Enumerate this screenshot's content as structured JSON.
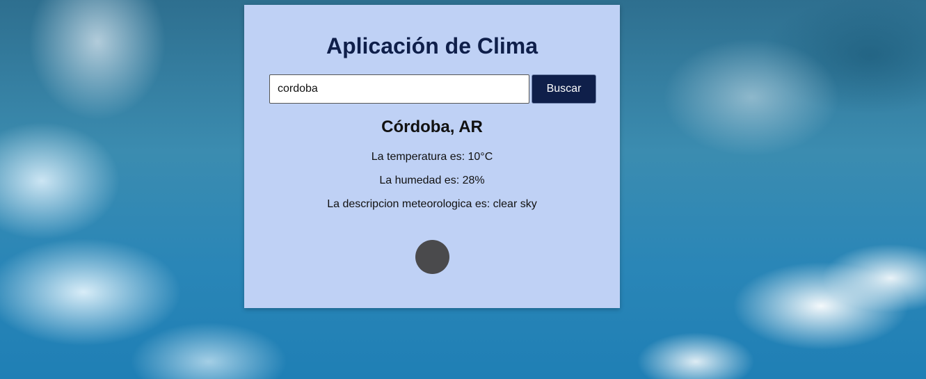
{
  "app": {
    "title": "Aplicación de Clima"
  },
  "search": {
    "value": "cordoba",
    "placeholder": "",
    "button_label": "Buscar"
  },
  "weather": {
    "city": "Córdoba, AR",
    "temperature_text": "La temperatura es: 10°C",
    "humidity_text": "La humedad es: 28%",
    "description_text": "La descripcion meteorologica es: clear sky",
    "icon": "weather-icon"
  },
  "colors": {
    "card_background": "#bfd1f5",
    "title_color": "#0f1f4a",
    "button_background": "#0f1f4a",
    "icon_color": "#4a4a4c"
  }
}
